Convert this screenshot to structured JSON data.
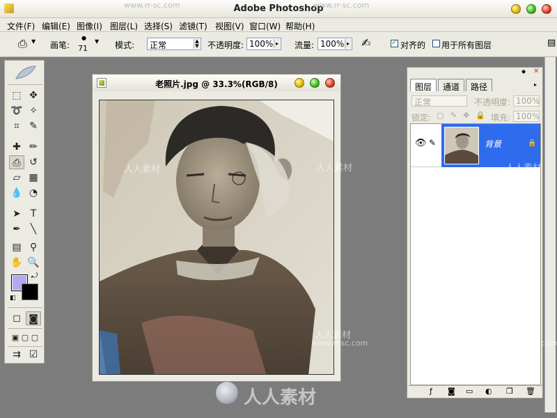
{
  "app": {
    "title": "Adobe Photoshop"
  },
  "menu": [
    {
      "label": "文件(F)"
    },
    {
      "label": "编辑(E)"
    },
    {
      "label": "图像(I)"
    },
    {
      "label": "图层(L)"
    },
    {
      "label": "选择(S)"
    },
    {
      "label": "滤镜(T)"
    },
    {
      "label": "视图(V)"
    },
    {
      "label": "窗口(W)"
    },
    {
      "label": "帮助(H)"
    }
  ],
  "options": {
    "brush_label": "画笔:",
    "brush_size": "71",
    "mode_label": "模式:",
    "mode_value": "正常",
    "opacity_label": "不透明度:",
    "opacity_value": "100%",
    "flow_label": "流量:",
    "flow_value": "100%",
    "aligned_label": "对齐的",
    "aligned_checked": true,
    "all_layers_label": "用于所有图层",
    "all_layers_checked": false
  },
  "document": {
    "title": "老照片.jpg @ 33.3%(RGB/8)"
  },
  "layers_panel": {
    "tabs": [
      {
        "label": "图层",
        "active": true
      },
      {
        "label": "通道",
        "active": false
      },
      {
        "label": "路径",
        "active": false
      }
    ],
    "blend_mode": "正常",
    "opacity_label": "不透明度:",
    "opacity_value": "100%",
    "lock_label": "锁定:",
    "fill_label": "填充:",
    "fill_value": "100%",
    "layers": [
      {
        "name": "背景",
        "visible": true,
        "locked": true,
        "selected": true
      }
    ]
  },
  "colors": {
    "foreground": "#b4a8ee",
    "background": "#000000",
    "selection": "#2f6bed"
  },
  "watermarks": {
    "url": "www.rr-sc.com",
    "cn": "人人素材"
  },
  "tools": [
    "marquee-icon",
    "move-icon",
    "lasso-icon",
    "magic-wand-icon",
    "crop-icon",
    "slice-icon",
    "healing-brush-icon",
    "brush-icon",
    "clone-stamp-icon",
    "history-brush-icon",
    "eraser-icon",
    "gradient-icon",
    "blur-icon",
    "dodge-icon",
    "path-select-icon",
    "type-icon",
    "pen-icon",
    "line-icon",
    "notes-icon",
    "eyedropper-icon",
    "hand-icon",
    "zoom-icon"
  ]
}
